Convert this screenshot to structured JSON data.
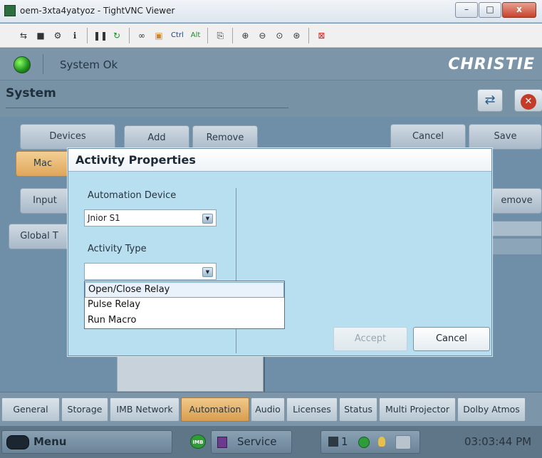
{
  "window": {
    "title": "oem-3xta4yatyoz - TightVNC Viewer",
    "min": "–",
    "max": "□",
    "close": "x"
  },
  "toolbar": {
    "ctrl": "Ctrl",
    "alt": "Alt"
  },
  "header": {
    "status": "System Ok",
    "logo": "CHRISTIE"
  },
  "section": {
    "title": "System"
  },
  "side_tabs": [
    {
      "label": "Devices"
    },
    {
      "label": "Mac"
    },
    {
      "label": "Input"
    },
    {
      "label": "Global T"
    }
  ],
  "actions": {
    "add": "Add",
    "remove": "Remove",
    "cancel": "Cancel",
    "save": "Save",
    "remove_partial": "emove"
  },
  "dialog": {
    "title": "Activity Properties",
    "automation_device_label": "Automation Device",
    "automation_device_value": "Jnior S1",
    "activity_type_label": "Activity Type",
    "activity_type_value": "",
    "options": [
      "Open/Close Relay",
      "Pulse Relay",
      "Run Macro"
    ],
    "selected_option": 0,
    "accept": "Accept",
    "cancel": "Cancel"
  },
  "bottom_tabs": [
    "General",
    "Storage",
    "IMB Network",
    "Automation",
    "Audio",
    "Licenses",
    "Status",
    "Multi Projector",
    "Dolby Atmos"
  ],
  "active_bottom_tab": "Automation",
  "footer": {
    "menu": "Menu",
    "service": "Service",
    "badge": "IMB",
    "count": "1",
    "time": "03:03:44 PM"
  },
  "colors": {
    "accent_orange": "#e0a65a",
    "dialog_bg": "#b8dff0",
    "header_bg": "#7c95a9",
    "ok_green": "#1e8e1b"
  }
}
